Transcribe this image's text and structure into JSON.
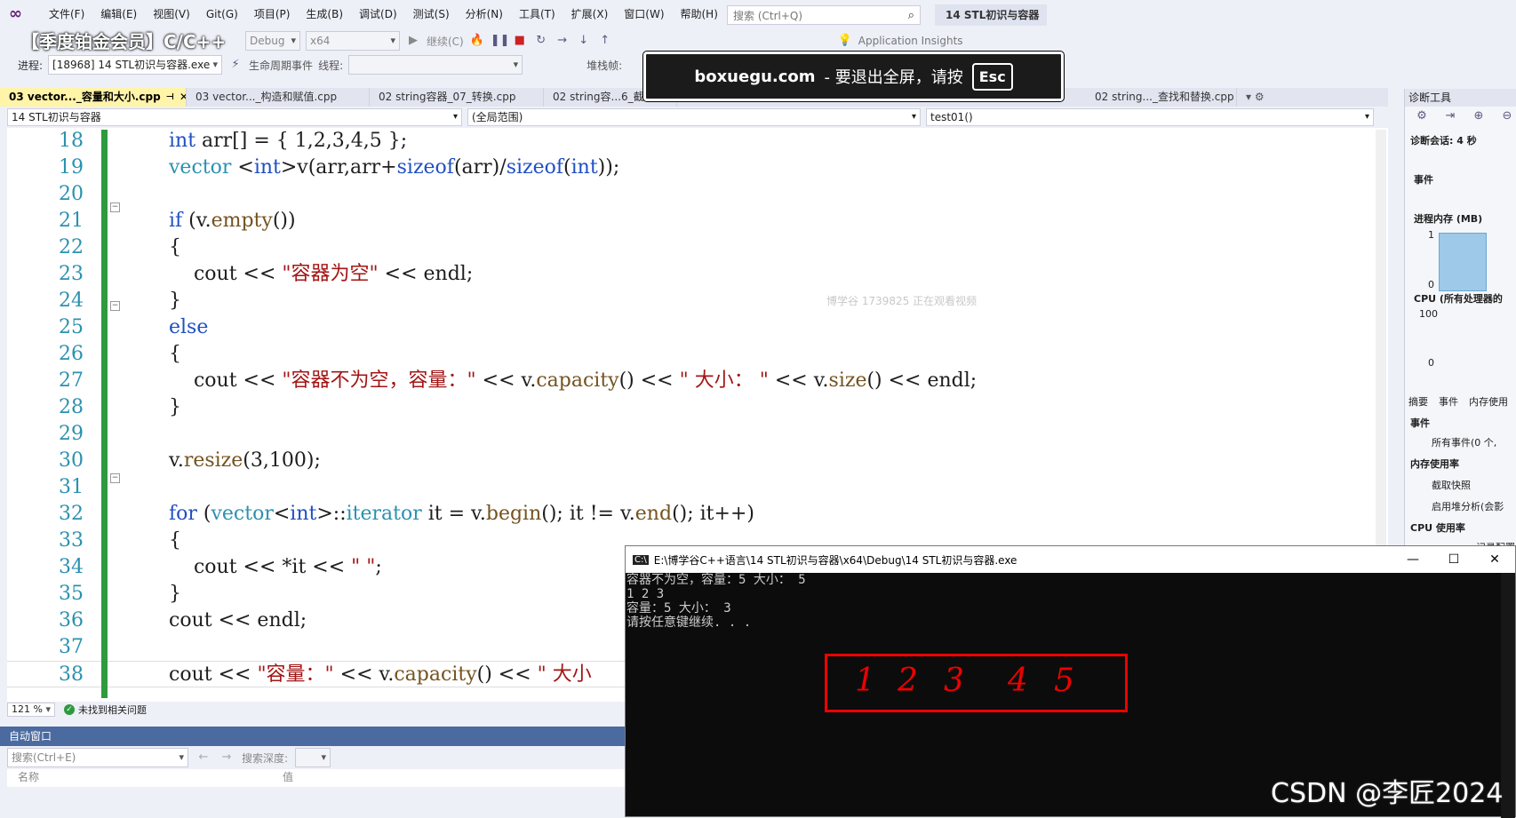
{
  "menubar": {
    "items": [
      "文件(F)",
      "编辑(E)",
      "视图(V)",
      "Git(G)",
      "项目(P)",
      "生成(B)",
      "调试(D)",
      "测试(S)",
      "分析(N)",
      "工具(T)",
      "扩展(X)",
      "窗口(W)",
      "帮助(H)"
    ],
    "search_placeholder": "搜索 (Ctrl+Q)",
    "solution_title": "14 STL初识与容器"
  },
  "toolbar": {
    "config": "Debug",
    "platform": "x64",
    "continue": "继续(C)",
    "app_insights": "Application Insights",
    "process_label": "进程:",
    "process_value": "[18968] 14 STL初识与容器.exe",
    "lifecycle": "生命周期事件",
    "thread_label": "线程:",
    "stack_label": "堆栈帧:"
  },
  "banner": "【季度铂金会员】C/C++",
  "fullscreen": {
    "site": "boxuegu.com",
    "msg": "-  要退出全屏，请按",
    "key": "Esc"
  },
  "tabs": [
    "03 vector..._容量和大小.cpp",
    "03 vector..._构造和赋值.cpp",
    "02 string容器_07_转换.cpp",
    "02 string容...6_截",
    "02 string..._查找和替换.cpp"
  ],
  "nav": {
    "project": "14 STL初识与容器",
    "scope": "(全局范围)",
    "function": "test01()"
  },
  "editor": {
    "line_numbers": [
      "18",
      "19",
      "20",
      "21",
      "22",
      "23",
      "24",
      "25",
      "26",
      "27",
      "28",
      "29",
      "30",
      "31",
      "32",
      "33",
      "34",
      "35",
      "36",
      "37",
      "38"
    ],
    "zoom": "121 %",
    "status": "未找到相关问题"
  },
  "watermark": "博学谷 1739825 正在观看视频",
  "autos": {
    "title": "自动窗口",
    "search": "搜索(Ctrl+E)",
    "depth_label": "搜索深度:",
    "col_name": "名称",
    "col_value": "值"
  },
  "diag": {
    "title": "诊断工具",
    "session": "诊断会话: 4 秒",
    "events": "事件",
    "memory": "进程内存 (MB)",
    "mem_top": "1",
    "mem_bottom": "0",
    "cpu": "CPU (所有处理器的",
    "cpu_top": "100",
    "cpu_bottom": "0",
    "tabs": [
      "摘要",
      "事件",
      "内存使用"
    ],
    "events_header": "事件",
    "all_events": "所有事件(0 个,",
    "mem_usage": "内存使用率",
    "snapshot": "截取快照",
    "heap": "启用堆分析(会影",
    "cpu_usage": "CPU 使用率",
    "cpu_extra": "记录配置文"
  },
  "console": {
    "title": "E:\\博学谷C++语言\\14 STL初识与容器\\x64\\Debug\\14 STL初识与容器.exe",
    "lines": [
      "容器不为空，容量：5 大小： 5",
      "1 2 3",
      "容量：5 大小： 3",
      "请按任意键继续. . ."
    ]
  },
  "annotation": {
    "digits": [
      "1",
      "2",
      "3",
      "4",
      "5"
    ],
    "color": "#e00000"
  },
  "csdn": "CSDN @李匠2024"
}
